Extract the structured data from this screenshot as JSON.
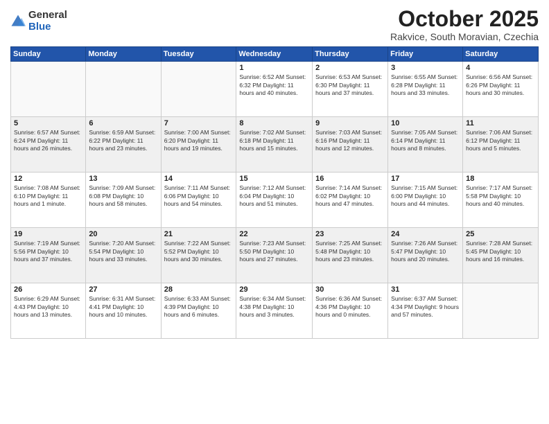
{
  "logo": {
    "general": "General",
    "blue": "Blue"
  },
  "header": {
    "title": "October 2025",
    "location": "Rakvice, South Moravian, Czechia"
  },
  "weekdays": [
    "Sunday",
    "Monday",
    "Tuesday",
    "Wednesday",
    "Thursday",
    "Friday",
    "Saturday"
  ],
  "rows": [
    [
      {
        "day": "",
        "info": ""
      },
      {
        "day": "",
        "info": ""
      },
      {
        "day": "",
        "info": ""
      },
      {
        "day": "1",
        "info": "Sunrise: 6:52 AM\nSunset: 6:32 PM\nDaylight: 11 hours\nand 40 minutes."
      },
      {
        "day": "2",
        "info": "Sunrise: 6:53 AM\nSunset: 6:30 PM\nDaylight: 11 hours\nand 37 minutes."
      },
      {
        "day": "3",
        "info": "Sunrise: 6:55 AM\nSunset: 6:28 PM\nDaylight: 11 hours\nand 33 minutes."
      },
      {
        "day": "4",
        "info": "Sunrise: 6:56 AM\nSunset: 6:26 PM\nDaylight: 11 hours\nand 30 minutes."
      }
    ],
    [
      {
        "day": "5",
        "info": "Sunrise: 6:57 AM\nSunset: 6:24 PM\nDaylight: 11 hours\nand 26 minutes."
      },
      {
        "day": "6",
        "info": "Sunrise: 6:59 AM\nSunset: 6:22 PM\nDaylight: 11 hours\nand 23 minutes."
      },
      {
        "day": "7",
        "info": "Sunrise: 7:00 AM\nSunset: 6:20 PM\nDaylight: 11 hours\nand 19 minutes."
      },
      {
        "day": "8",
        "info": "Sunrise: 7:02 AM\nSunset: 6:18 PM\nDaylight: 11 hours\nand 15 minutes."
      },
      {
        "day": "9",
        "info": "Sunrise: 7:03 AM\nSunset: 6:16 PM\nDaylight: 11 hours\nand 12 minutes."
      },
      {
        "day": "10",
        "info": "Sunrise: 7:05 AM\nSunset: 6:14 PM\nDaylight: 11 hours\nand 8 minutes."
      },
      {
        "day": "11",
        "info": "Sunrise: 7:06 AM\nSunset: 6:12 PM\nDaylight: 11 hours\nand 5 minutes."
      }
    ],
    [
      {
        "day": "12",
        "info": "Sunrise: 7:08 AM\nSunset: 6:10 PM\nDaylight: 11 hours\nand 1 minute."
      },
      {
        "day": "13",
        "info": "Sunrise: 7:09 AM\nSunset: 6:08 PM\nDaylight: 10 hours\nand 58 minutes."
      },
      {
        "day": "14",
        "info": "Sunrise: 7:11 AM\nSunset: 6:06 PM\nDaylight: 10 hours\nand 54 minutes."
      },
      {
        "day": "15",
        "info": "Sunrise: 7:12 AM\nSunset: 6:04 PM\nDaylight: 10 hours\nand 51 minutes."
      },
      {
        "day": "16",
        "info": "Sunrise: 7:14 AM\nSunset: 6:02 PM\nDaylight: 10 hours\nand 47 minutes."
      },
      {
        "day": "17",
        "info": "Sunrise: 7:15 AM\nSunset: 6:00 PM\nDaylight: 10 hours\nand 44 minutes."
      },
      {
        "day": "18",
        "info": "Sunrise: 7:17 AM\nSunset: 5:58 PM\nDaylight: 10 hours\nand 40 minutes."
      }
    ],
    [
      {
        "day": "19",
        "info": "Sunrise: 7:19 AM\nSunset: 5:56 PM\nDaylight: 10 hours\nand 37 minutes."
      },
      {
        "day": "20",
        "info": "Sunrise: 7:20 AM\nSunset: 5:54 PM\nDaylight: 10 hours\nand 33 minutes."
      },
      {
        "day": "21",
        "info": "Sunrise: 7:22 AM\nSunset: 5:52 PM\nDaylight: 10 hours\nand 30 minutes."
      },
      {
        "day": "22",
        "info": "Sunrise: 7:23 AM\nSunset: 5:50 PM\nDaylight: 10 hours\nand 27 minutes."
      },
      {
        "day": "23",
        "info": "Sunrise: 7:25 AM\nSunset: 5:48 PM\nDaylight: 10 hours\nand 23 minutes."
      },
      {
        "day": "24",
        "info": "Sunrise: 7:26 AM\nSunset: 5:47 PM\nDaylight: 10 hours\nand 20 minutes."
      },
      {
        "day": "25",
        "info": "Sunrise: 7:28 AM\nSunset: 5:45 PM\nDaylight: 10 hours\nand 16 minutes."
      }
    ],
    [
      {
        "day": "26",
        "info": "Sunrise: 6:29 AM\nSunset: 4:43 PM\nDaylight: 10 hours\nand 13 minutes."
      },
      {
        "day": "27",
        "info": "Sunrise: 6:31 AM\nSunset: 4:41 PM\nDaylight: 10 hours\nand 10 minutes."
      },
      {
        "day": "28",
        "info": "Sunrise: 6:33 AM\nSunset: 4:39 PM\nDaylight: 10 hours\nand 6 minutes."
      },
      {
        "day": "29",
        "info": "Sunrise: 6:34 AM\nSunset: 4:38 PM\nDaylight: 10 hours\nand 3 minutes."
      },
      {
        "day": "30",
        "info": "Sunrise: 6:36 AM\nSunset: 4:36 PM\nDaylight: 10 hours\nand 0 minutes."
      },
      {
        "day": "31",
        "info": "Sunrise: 6:37 AM\nSunset: 4:34 PM\nDaylight: 9 hours\nand 57 minutes."
      },
      {
        "day": "",
        "info": ""
      }
    ]
  ]
}
